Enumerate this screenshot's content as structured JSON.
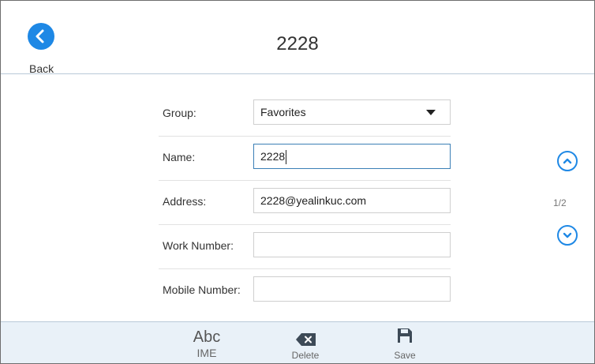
{
  "header": {
    "title": "2228",
    "back_label": "Back"
  },
  "form": {
    "group": {
      "label": "Group:",
      "value": "Favorites"
    },
    "name": {
      "label": "Name:",
      "value": "2228"
    },
    "address": {
      "label": "Address:",
      "value": "2228@yealinkuc.com"
    },
    "work_number": {
      "label": "Work Number:",
      "value": ""
    },
    "mobile_number": {
      "label": "Mobile Number:",
      "value": ""
    }
  },
  "pager": {
    "indicator": "1/2"
  },
  "softkeys": {
    "ime_glyph": "Abc",
    "ime_label": "IME",
    "delete_label": "Delete",
    "save_label": "Save"
  },
  "colors": {
    "accent": "#1e88e5",
    "softkey_bar": "#e9f1f8",
    "focus_border": "#3b7fb6"
  }
}
